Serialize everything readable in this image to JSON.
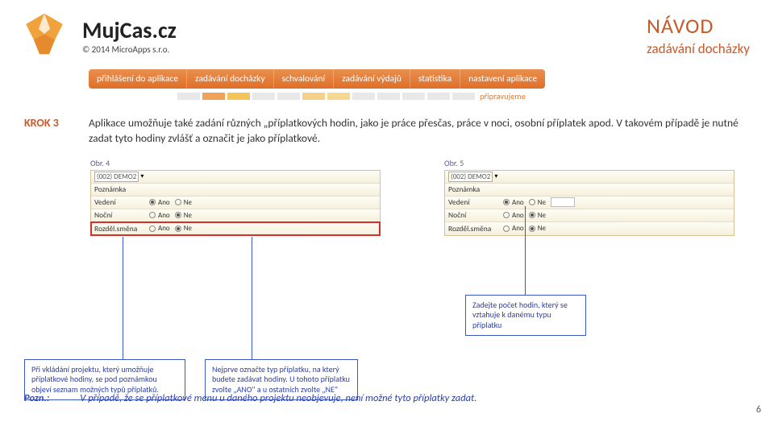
{
  "brand": {
    "title": "MujCas.cz",
    "copyright": "© 2014 MicroApps s.r.o."
  },
  "guide": {
    "title": "NÁVOD",
    "subtitle": "zadávání docházky"
  },
  "tabs": {
    "items": [
      "přihlášení do aplikace",
      "zadávání docházky",
      "schvalování",
      "zadávání výdajů",
      "statistika",
      "nastavení aplikace"
    ],
    "preparing_label": "připravujeme",
    "prep_colors": [
      "#e8e8e8",
      "#f2a257",
      "#f4c45a",
      "#e8e8e8",
      "#e8e8e8",
      "#f6d08a",
      "#f6d890",
      "#e8e8e8",
      "#e8e8e8",
      "#e8e8e8",
      "#e8e8e8",
      "#e8e8e8"
    ]
  },
  "step": {
    "label": "KROK 3",
    "text": "Aplikace umožňuje také zadání různých „příplatkových hodin, jako je práce přesčas, práce v noci, osobní příplatek apod. V takovém případě je nutné zadat tyto hodiny zvlášť a označit je jako příplatkové."
  },
  "figs": {
    "left_label": "Obr. 4",
    "right_label": "Obr. 5",
    "project": "(002) DEMO2",
    "note_label": "Poznámka",
    "rows": {
      "vedeni": "Vedení",
      "nocni": "Noční",
      "rozd": "Rozděl.směna"
    },
    "radio": {
      "yes": "Ano",
      "no": "Ne"
    }
  },
  "callouts": {
    "c1": "Při vkládání projektu, který umožňuje příplatkové hodiny, se pod poznámkou objeví seznam možných typů příplatků.",
    "c2": "Nejprve označte typ příplatku, na který budete zadávat hodiny. U tohoto příplatku zvolte „ANO\" a u ostatních zvolte „NE\"",
    "c3": "Zadejte počet hodin, který se vztahuje k danému typu příplatku"
  },
  "footer": {
    "note_label": "Pozn.:",
    "note_text": "V případě, že se příplatkové menu u daného projektu neobjevuje, není možné tyto příplatky zadat."
  },
  "page_number": "6"
}
